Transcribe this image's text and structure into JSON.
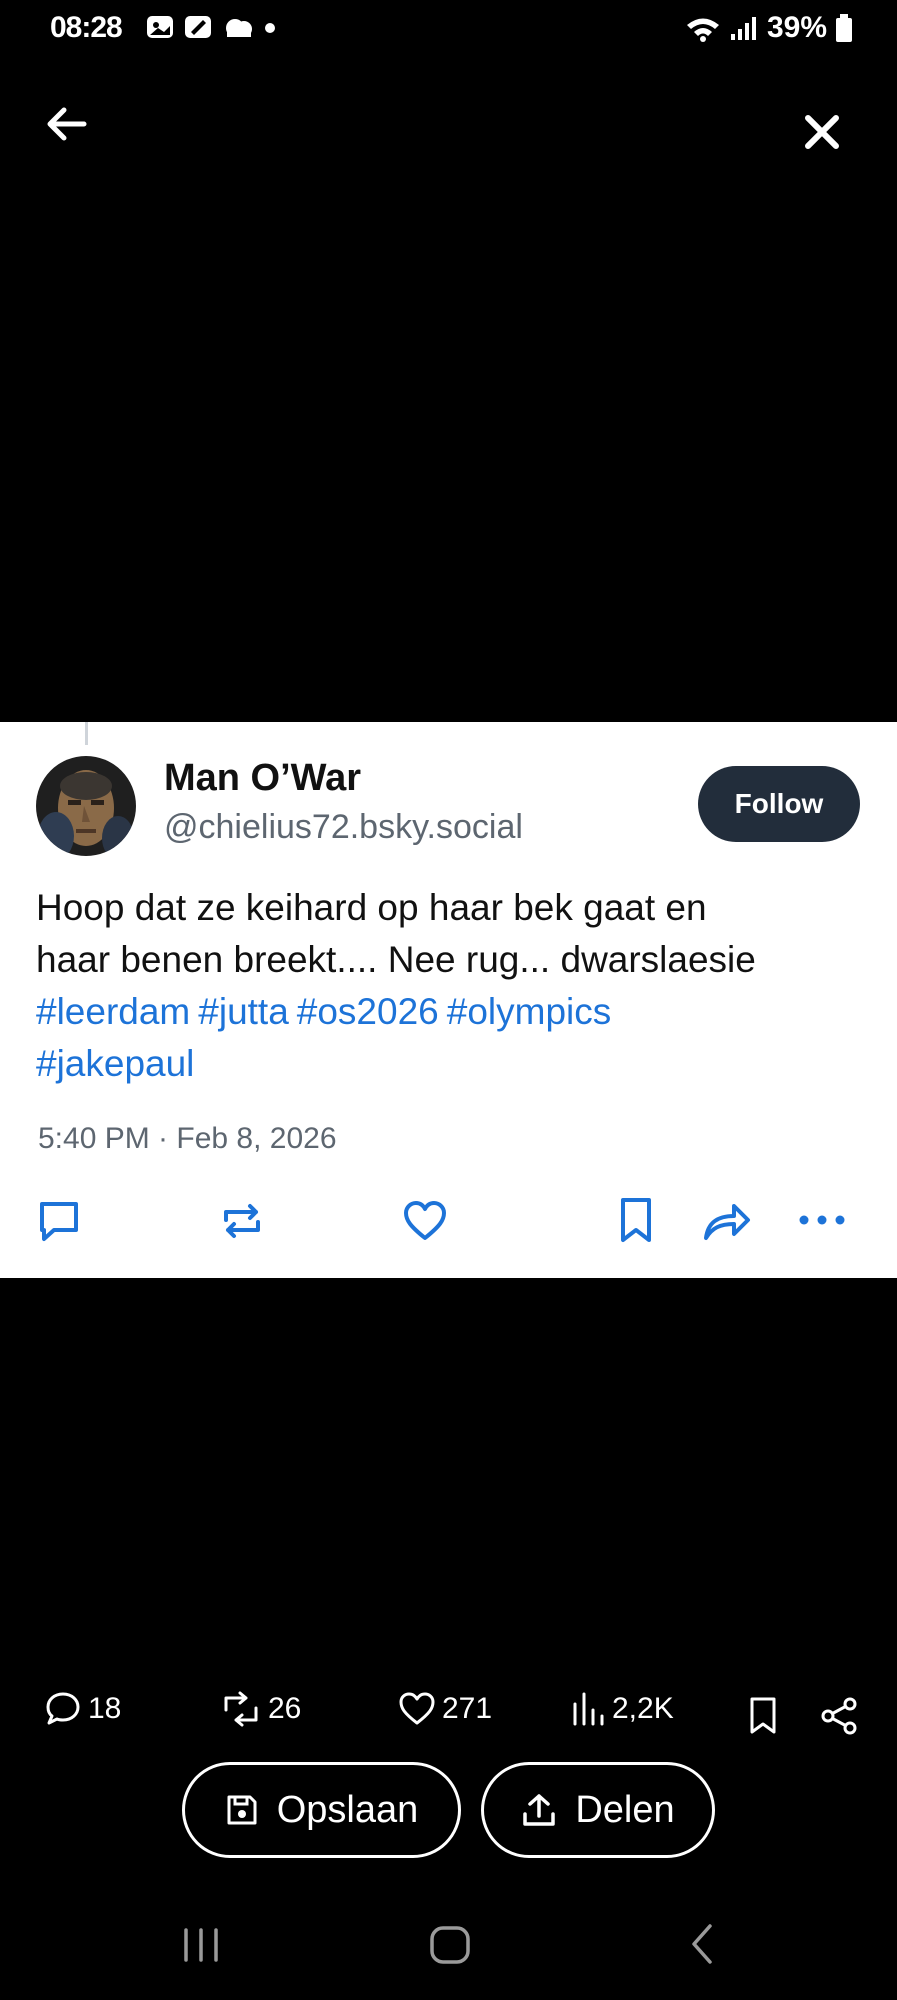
{
  "status_bar": {
    "time": "08:28",
    "battery": "39%"
  },
  "post": {
    "author_name": "Man O’War",
    "author_handle": "@chielius72.bsky.social",
    "follow_label": "Follow",
    "text_line1": "Hoop dat ze keihard op haar bek gaat  en",
    "text_line2": "haar benen breekt.... Nee rug... dwarslaesie",
    "hashtags": [
      "#leerdam",
      "#jutta",
      "#os2026",
      "#olympics",
      "#jakepaul"
    ],
    "timestamp": "5:40 PM · Feb 8, 2026"
  },
  "stats": {
    "replies": "18",
    "reposts": "26",
    "likes": "271",
    "views": "2,2K"
  },
  "buttons": {
    "save_label": "Opslaan",
    "share_label": "Delen"
  },
  "icons": [
    "back-arrow-icon",
    "close-icon",
    "reply-icon",
    "repost-icon",
    "heart-icon",
    "bookmark-icon",
    "share-icon",
    "more-icon",
    "views-icon",
    "save-icon",
    "upload-icon"
  ],
  "colors": {
    "hashtag": "#1d73d8",
    "follow_bg": "#222d3b",
    "background": "#000000",
    "card": "#ffffff"
  }
}
